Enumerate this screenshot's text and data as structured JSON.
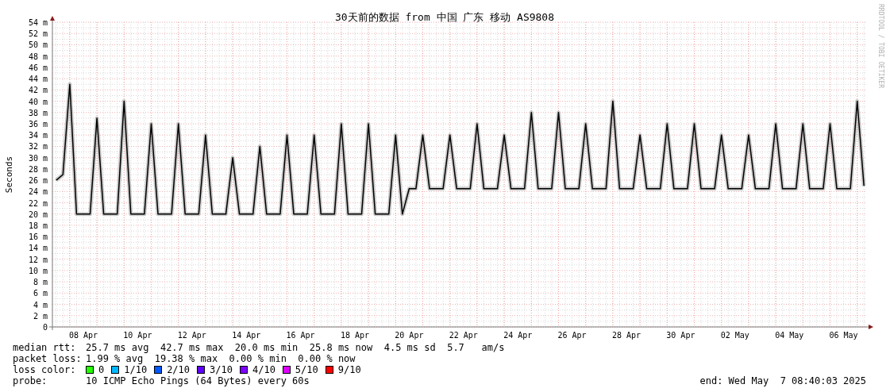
{
  "chart": {
    "chart_data": {
      "type": "line",
      "title": "30天前的数据 from 中国 广东 移动 AS9808",
      "ylabel": "Seconds",
      "grid": true,
      "ylim": [
        0,
        54
      ],
      "categories": [
        null,
        null,
        null,
        null,
        "08 Apr",
        null,
        null,
        null,
        null,
        null,
        null,
        null,
        "10 Apr",
        null,
        null,
        null,
        null,
        null,
        null,
        null,
        "12 Apr",
        null,
        null,
        null,
        null,
        null,
        null,
        null,
        "14 Apr",
        null,
        null,
        null,
        null,
        null,
        null,
        null,
        "16 Apr",
        null,
        null,
        null,
        null,
        null,
        null,
        null,
        "18 Apr",
        null,
        null,
        null,
        null,
        null,
        null,
        null,
        "20 Apr",
        null,
        null,
        null,
        null,
        null,
        null,
        null,
        "22 Apr",
        null,
        null,
        null,
        null,
        null,
        null,
        null,
        "24 Apr",
        null,
        null,
        null,
        null,
        null,
        null,
        null,
        "26 Apr",
        null,
        null,
        null,
        null,
        null,
        null,
        null,
        "28 Apr",
        null,
        null,
        null,
        null,
        null,
        null,
        null,
        "30 Apr",
        null,
        null,
        null,
        null,
        null,
        null,
        null,
        "02 May",
        null,
        null,
        null,
        null,
        null,
        null,
        null,
        "04 May",
        null,
        null,
        null,
        null,
        null,
        null,
        null,
        "06 May",
        null,
        null,
        null
      ],
      "series": [
        {
          "color": "#000000",
          "values": [
            26,
            27,
            43,
            20,
            20,
            20,
            37,
            20,
            20,
            20,
            40,
            20,
            20,
            20,
            36,
            20,
            20,
            20,
            36,
            20,
            20,
            20,
            34,
            20,
            20,
            20,
            30,
            20,
            20,
            20,
            32,
            20,
            20,
            20,
            34,
            20,
            20,
            20,
            34,
            20,
            20,
            20,
            36,
            20,
            20,
            20,
            36,
            20,
            20,
            20,
            34,
            20,
            24.5,
            24.5,
            34,
            24.5,
            24.5,
            24.5,
            34,
            24.5,
            24.5,
            24.5,
            36,
            24.5,
            24.5,
            24.5,
            34,
            24.5,
            24.5,
            24.5,
            38,
            24.5,
            24.5,
            24.5,
            38,
            24.5,
            24.5,
            24.5,
            36,
            24.5,
            24.5,
            24.5,
            40,
            24.5,
            24.5,
            24.5,
            34,
            24.5,
            24.5,
            24.5,
            36,
            24.5,
            24.5,
            24.5,
            36,
            24.5,
            24.5,
            24.5,
            34,
            24.5,
            24.5,
            24.5,
            34,
            24.5,
            24.5,
            24.5,
            36,
            24.5,
            24.5,
            24.5,
            36,
            24.5,
            24.5,
            24.5,
            36,
            24.5,
            24.5,
            24.5,
            40,
            25
          ]
        }
      ],
      "yticks": [
        {
          "value": 0,
          "label": "0"
        },
        {
          "value": 2,
          "label": "2 m"
        },
        {
          "value": 4,
          "label": "4 m"
        },
        {
          "value": 6,
          "label": "6 m"
        },
        {
          "value": 8,
          "label": "8 m"
        },
        {
          "value": 10,
          "label": "10 m"
        },
        {
          "value": 12,
          "label": "12 m"
        },
        {
          "value": 14,
          "label": "14 m"
        },
        {
          "value": 16,
          "label": "16 m"
        },
        {
          "value": 18,
          "label": "18 m"
        },
        {
          "value": 20,
          "label": "20 m"
        },
        {
          "value": 22,
          "label": "22 m"
        },
        {
          "value": 24,
          "label": "24 m"
        },
        {
          "value": 26,
          "label": "26 m"
        },
        {
          "value": 28,
          "label": "28 m"
        },
        {
          "value": 30,
          "label": "30 m"
        },
        {
          "value": 32,
          "label": "32 m"
        },
        {
          "value": 34,
          "label": "34 m"
        },
        {
          "value": 36,
          "label": "36 m"
        },
        {
          "value": 38,
          "label": "38 m"
        },
        {
          "value": 40,
          "label": "40 m"
        },
        {
          "value": 42,
          "label": "42 m"
        },
        {
          "value": 44,
          "label": "44 m"
        },
        {
          "value": 46,
          "label": "46 m"
        },
        {
          "value": 48,
          "label": "48 m"
        },
        {
          "value": 50,
          "label": "50 m"
        },
        {
          "value": 52,
          "label": "52 m"
        },
        {
          "value": 54,
          "label": "54 m"
        }
      ]
    },
    "credit": "RRDTOOL / TOBI OETIKER"
  },
  "legend": {
    "median_rtt": {
      "label": "median rtt:",
      "text": "25.7 ms avg  42.7 ms max  20.0 ms min  25.8 ms now  4.5 ms sd  5.7   am/s"
    },
    "packet_loss": {
      "label": "packet loss:",
      "text": "1.99 % avg  19.38 % max  0.00 % min  0.00 % now"
    },
    "loss_color": {
      "label": "loss color:",
      "items": [
        {
          "label": "0",
          "color": "#26ff00"
        },
        {
          "label": "1/10",
          "color": "#00b8ff"
        },
        {
          "label": "2/10",
          "color": "#0059ff"
        },
        {
          "label": "3/10",
          "color": "#5e00ff"
        },
        {
          "label": "4/10",
          "color": "#7e00ff"
        },
        {
          "label": "5/10",
          "color": "#dd00ff"
        },
        {
          "label": "9/10",
          "color": "#ff0000"
        }
      ]
    },
    "probe": {
      "label": "probe:",
      "text": "10 ICMP Echo Pings (64 Bytes) every 60s"
    },
    "end": "end: Wed May  7 08:40:03 2025"
  }
}
